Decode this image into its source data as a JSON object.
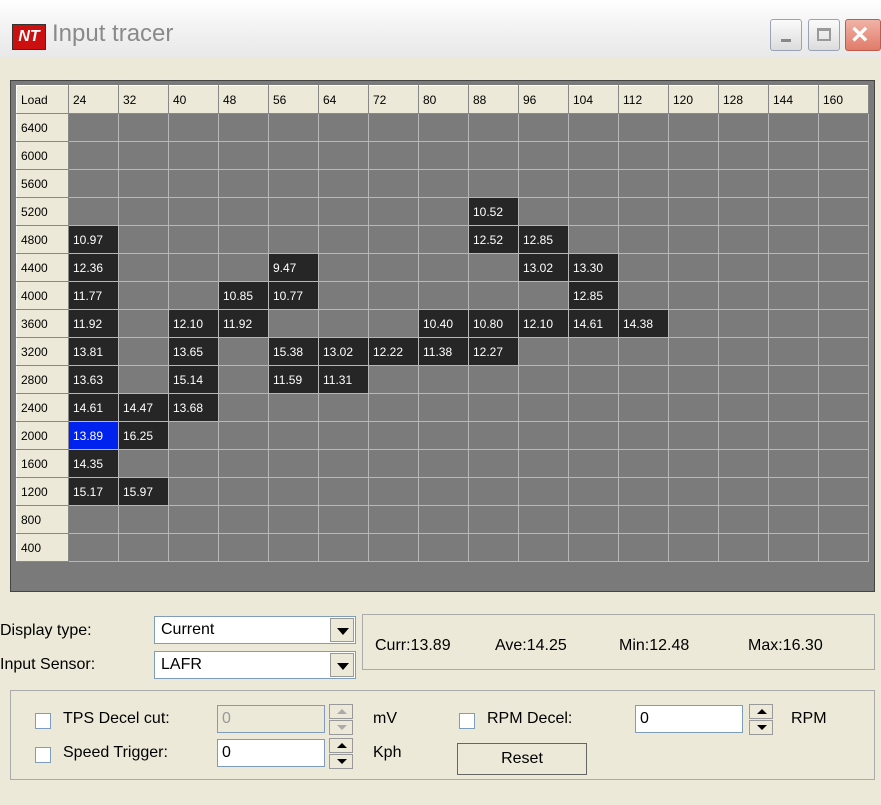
{
  "window": {
    "title": "Input tracer",
    "icon_text": "NT"
  },
  "grid": {
    "corner_label": "Load",
    "columns": [
      "24",
      "32",
      "40",
      "48",
      "56",
      "64",
      "72",
      "80",
      "88",
      "96",
      "104",
      "112",
      "120",
      "128",
      "144",
      "160"
    ],
    "rows": [
      {
        "label": "6400",
        "cells": [
          "",
          "",
          "",
          "",
          "",
          "",
          "",
          "",
          "",
          "",
          "",
          "",
          "",
          "",
          "",
          ""
        ]
      },
      {
        "label": "6000",
        "cells": [
          "",
          "",
          "",
          "",
          "",
          "",
          "",
          "",
          "",
          "",
          "",
          "",
          "",
          "",
          "",
          ""
        ]
      },
      {
        "label": "5600",
        "cells": [
          "",
          "",
          "",
          "",
          "",
          "",
          "",
          "",
          "",
          "",
          "",
          "",
          "",
          "",
          "",
          ""
        ]
      },
      {
        "label": "5200",
        "cells": [
          "",
          "",
          "",
          "",
          "",
          "",
          "",
          "",
          "10.52",
          "",
          "",
          "",
          "",
          "",
          "",
          ""
        ]
      },
      {
        "label": "4800",
        "cells": [
          "10.97",
          "",
          "",
          "",
          "",
          "",
          "",
          "",
          "12.52",
          "12.85",
          "",
          "",
          "",
          "",
          "",
          ""
        ]
      },
      {
        "label": "4400",
        "cells": [
          "12.36",
          "",
          "",
          "",
          "9.47",
          "",
          "",
          "",
          "",
          "13.02",
          "13.30",
          "",
          "",
          "",
          "",
          ""
        ]
      },
      {
        "label": "4000",
        "cells": [
          "11.77",
          "",
          "",
          "10.85",
          "10.77",
          "",
          "",
          "",
          "",
          "",
          "12.85",
          "",
          "",
          "",
          "",
          ""
        ]
      },
      {
        "label": "3600",
        "cells": [
          "11.92",
          "",
          "12.10",
          "11.92",
          "",
          "",
          "",
          "10.40",
          "10.80",
          "12.10",
          "14.61",
          "14.38",
          "",
          "",
          "",
          ""
        ]
      },
      {
        "label": "3200",
        "cells": [
          "13.81",
          "",
          "13.65",
          "",
          "15.38",
          "13.02",
          "12.22",
          "11.38",
          "12.27",
          "",
          "",
          "",
          "",
          "",
          "",
          ""
        ]
      },
      {
        "label": "2800",
        "cells": [
          "13.63",
          "",
          "15.14",
          "",
          "11.59",
          "11.31",
          "",
          "",
          "",
          "",
          "",
          "",
          "",
          "",
          "",
          ""
        ]
      },
      {
        "label": "2400",
        "cells": [
          "14.61",
          "14.47",
          "13.68",
          "",
          "",
          "",
          "",
          "",
          "",
          "",
          "",
          "",
          "",
          "",
          "",
          ""
        ]
      },
      {
        "label": "2000",
        "cells": [
          "13.89",
          "16.25",
          "",
          "",
          "",
          "",
          "",
          "",
          "",
          "",
          "",
          "",
          "",
          "",
          "",
          ""
        ]
      },
      {
        "label": "1600",
        "cells": [
          "14.35",
          "",
          "",
          "",
          "",
          "",
          "",
          "",
          "",
          "",
          "",
          "",
          "",
          "",
          "",
          ""
        ]
      },
      {
        "label": "1200",
        "cells": [
          "15.17",
          "15.97",
          "",
          "",
          "",
          "",
          "",
          "",
          "",
          "",
          "",
          "",
          "",
          "",
          "",
          ""
        ]
      },
      {
        "label": "800",
        "cells": [
          "",
          "",
          "",
          "",
          "",
          "",
          "",
          "",
          "",
          "",
          "",
          "",
          "",
          "",
          "",
          ""
        ]
      },
      {
        "label": "400",
        "cells": [
          "",
          "",
          "",
          "",
          "",
          "",
          "",
          "",
          "",
          "",
          "",
          "",
          "",
          "",
          "",
          ""
        ]
      }
    ],
    "selected": {
      "row": 11,
      "col": 0
    },
    "colors": {
      "empty": "#7b7b7b",
      "filled": "#262626",
      "selected": "#0022ee"
    }
  },
  "display_type": {
    "label": "Display type:",
    "value": "Current"
  },
  "input_sensor": {
    "label": "Input Sensor:",
    "value": "LAFR"
  },
  "stats": {
    "curr": "Curr:13.89",
    "ave": "Ave:14.25",
    "min": "Min:12.48",
    "max": "Max:16.30"
  },
  "options": {
    "tps_decel": {
      "label": "TPS Decel cut:",
      "value": "0",
      "unit": "mV"
    },
    "speed_trigger": {
      "label": "Speed Trigger:",
      "value": "0",
      "unit": "Kph"
    },
    "rpm_decel": {
      "label": "RPM Decel:",
      "value": "0",
      "unit": "RPM"
    },
    "reset_label": "Reset"
  }
}
